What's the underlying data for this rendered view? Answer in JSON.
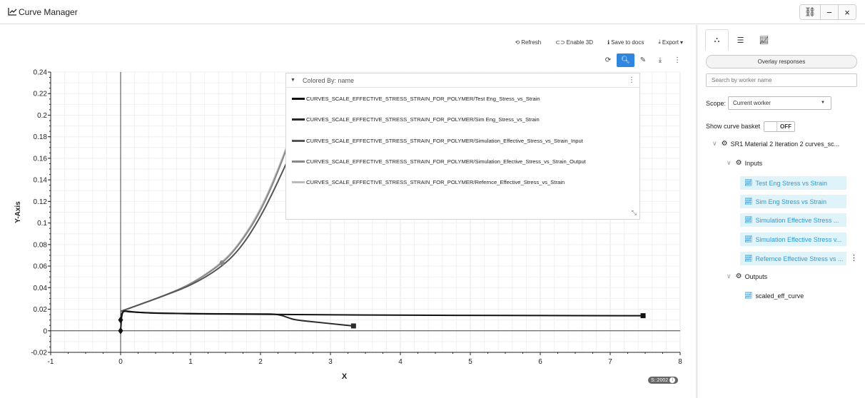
{
  "window": {
    "title": "Curve Manager",
    "controls": [
      "⛓",
      "−",
      "×"
    ]
  },
  "toolbar": {
    "refresh": "Refresh",
    "enable3d": "Enable 3D",
    "save_docs": "Save to docs",
    "export": "Export"
  },
  "legend": {
    "header": "Colored By: name",
    "entries": [
      {
        "label": "CURVES_SCALE_EFFECTIVE_STRESS_STRAIN_FOR_POLYMER/Test Eng_Stress_vs_Strain",
        "color": "#111111"
      },
      {
        "label": "CURVES_SCALE_EFFECTIVE_STRESS_STRAIN_FOR_POLYMER/Sim Eng_Stress_vs_Strain",
        "color": "#2a2a2a"
      },
      {
        "label": "CURVES_SCALE_EFFECTIVE_STRESS_STRAIN_FOR_POLYMER/Simulation_Effective_Stress_vs_Strain_Input",
        "color": "#555555"
      },
      {
        "label": "CURVES_SCALE_EFFECTIVE_STRESS_STRAIN_FOR_POLYMER/Simulation_Efective_Stress_vs_Strain_Output",
        "color": "#888888"
      },
      {
        "label": "CURVES_SCALE_EFFECTIVE_STRESS_STRAIN_FOR_POLYMER/Refernce_Effective_Stress_vs_Strain",
        "color": "#bbbbbb"
      }
    ]
  },
  "chart_data": {
    "type": "line",
    "xlabel": "X",
    "ylabel": "Y-Axis",
    "xlim": [
      -1,
      8
    ],
    "ylim": [
      -0.02,
      0.24
    ],
    "xticks": [
      "-1",
      "0",
      "1",
      "2",
      "3",
      "4",
      "5",
      "6",
      "7",
      "8"
    ],
    "yticks": [
      "-0.02",
      "0",
      "0.02",
      "0.04",
      "0.06",
      "0.08",
      "0.1",
      "0.12",
      "0.14",
      "0.16",
      "0.18",
      "0.2",
      "0.22",
      "0.24"
    ],
    "grid": true,
    "series": [
      {
        "name": "CURVES_SCALE_EFFECTIVE_STRESS_STRAIN_FOR_POLYMER/Test Eng_Stress_vs_Strain",
        "color": "#111111",
        "x": [
          0,
          0.02,
          0.1,
          0.5,
          1.0,
          2.0,
          3.0,
          4.0,
          5.0,
          6.0,
          7.0,
          7.47
        ],
        "y": [
          0,
          0.019,
          0.0175,
          0.0165,
          0.0158,
          0.0153,
          0.0148,
          0.0145,
          0.0143,
          0.0141,
          0.014,
          0.014
        ]
      },
      {
        "name": "CURVES_SCALE_EFFECTIVE_STRESS_STRAIN_FOR_POLYMER/Sim Eng_Stress_vs_Strain",
        "color": "#2a2a2a",
        "x": [
          0,
          0.02,
          0.2,
          0.5,
          1.0,
          1.5,
          2.0,
          2.25,
          2.4,
          2.5,
          2.8,
          3.1,
          3.33
        ],
        "y": [
          0.01,
          0.019,
          0.0172,
          0.0163,
          0.0159,
          0.0157,
          0.0156,
          0.0155,
          0.012,
          0.01,
          0.008,
          0.006,
          0.0045
        ]
      },
      {
        "name": "CURVES_SCALE_EFFECTIVE_STRESS_STRAIN_FOR_POLYMER/Simulation_Effective_Stress_vs_Strain_Input",
        "color": "#555555",
        "x": [
          0,
          0.3,
          0.6,
          1.0,
          1.4,
          1.7,
          2.0,
          2.3,
          2.55
        ],
        "y": [
          0.018,
          0.025,
          0.032,
          0.042,
          0.057,
          0.075,
          0.105,
          0.145,
          0.182
        ]
      },
      {
        "name": "CURVES_SCALE_EFFECTIVE_STRESS_STRAIN_FOR_POLYMER/Simulation_Efective_Stress_vs_Strain_Output",
        "color": "#888888",
        "x": [
          0,
          0.3,
          0.6,
          1.0,
          1.45,
          1.7,
          2.0,
          2.3,
          2.56
        ],
        "y": [
          0.018,
          0.025,
          0.032,
          0.043,
          0.062,
          0.08,
          0.11,
          0.155,
          0.204
        ]
      },
      {
        "name": "CURVES_SCALE_EFFECTIVE_STRESS_STRAIN_FOR_POLYMER/Refernce_Effective_Stress_vs_Strain",
        "color": "#bbbbbb",
        "x": [
          0,
          0.3,
          0.6,
          1.0,
          1.45,
          1.7,
          2.0,
          2.3,
          2.56
        ],
        "y": [
          0.018,
          0.025,
          0.032,
          0.043,
          0.063,
          0.081,
          0.112,
          0.157,
          0.205
        ]
      }
    ]
  },
  "badge": "S::2002",
  "sidebar": {
    "overlay_button": "Overlay responses",
    "search_placeholder": "Search by worker name",
    "scope_label": "Scope:",
    "scope_value": "Current worker",
    "basket_label": "Show curve basket",
    "basket_toggle": "OFF",
    "root": "SR1 Material 2 Iteration 2 curves_sc...",
    "inputs_label": "Inputs",
    "inputs": [
      "Test Eng Stress vs Strain",
      "Sim Eng Stress vs Strain",
      "Simulation Effective Stress ...",
      "Simulation Effective Stress v...",
      "Refernce Effective Stress vs ..."
    ],
    "outputs_label": "Outputs",
    "outputs": [
      "scaled_eff_curve"
    ]
  }
}
